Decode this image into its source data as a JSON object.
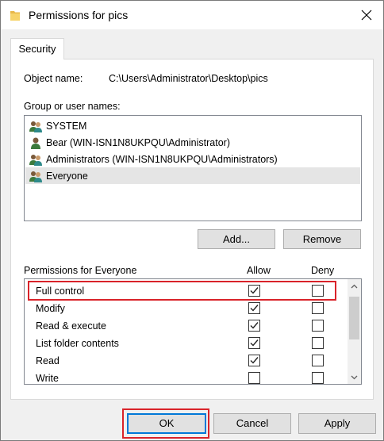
{
  "window": {
    "title": "Permissions for pics"
  },
  "tabs": [
    {
      "label": "Security"
    }
  ],
  "object": {
    "label": "Object name:",
    "value": "C:\\Users\\Administrator\\Desktop\\pics"
  },
  "groups": {
    "label": "Group or user names:",
    "items": [
      {
        "name": "SYSTEM",
        "icon": "users-group-icon",
        "selected": false
      },
      {
        "name": "Bear (WIN-ISN1N8UKPQU\\Administrator)",
        "icon": "user-icon",
        "selected": false
      },
      {
        "name": "Administrators (WIN-ISN1N8UKPQU\\Administrators)",
        "icon": "users-group-icon",
        "selected": false
      },
      {
        "name": "Everyone",
        "icon": "users-group-icon",
        "selected": true
      }
    ],
    "add_label": "Add...",
    "remove_label": "Remove"
  },
  "permissions": {
    "label": "Permissions for Everyone",
    "allow_label": "Allow",
    "deny_label": "Deny",
    "rows": [
      {
        "name": "Full control",
        "allow": true,
        "deny": false
      },
      {
        "name": "Modify",
        "allow": true,
        "deny": false
      },
      {
        "name": "Read & execute",
        "allow": true,
        "deny": false
      },
      {
        "name": "List folder contents",
        "allow": true,
        "deny": false
      },
      {
        "name": "Read",
        "allow": true,
        "deny": false
      },
      {
        "name": "Write",
        "allow": false,
        "deny": false
      }
    ]
  },
  "buttons": {
    "ok": "OK",
    "cancel": "Cancel",
    "apply": "Apply"
  },
  "colors": {
    "highlight": "#d9232a",
    "selected_row": "#e5e5e5",
    "ok_accent": "#0078d7"
  }
}
